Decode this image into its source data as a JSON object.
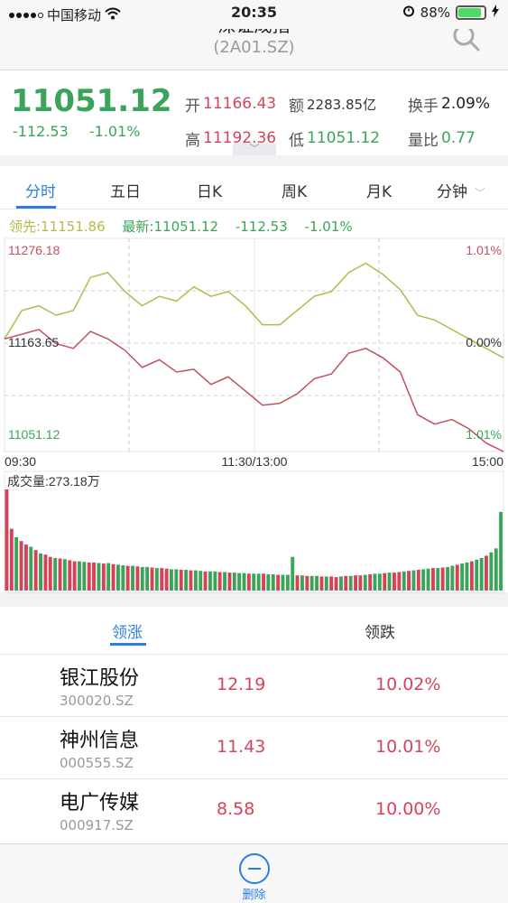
{
  "status_bar": {
    "carrier": "中国移动",
    "time": "20:35",
    "battery": "88%"
  },
  "header": {
    "title": "深证成指",
    "code": "(2A01.SZ)"
  },
  "quote": {
    "price": "11051.12",
    "change": "-112.53",
    "change_pct": "-1.01%",
    "open_label": "开",
    "open": "11166.43",
    "amount_label": "额",
    "amount": "2283.85亿",
    "turnover_label": "换手",
    "turnover": "2.09%",
    "high_label": "高",
    "high": "11192.36",
    "low_label": "低",
    "low": "11051.12",
    "vol_ratio_label": "量比",
    "vol_ratio": "0.77"
  },
  "tabs": [
    "分时",
    "五日",
    "日K",
    "周K",
    "月K",
    "分钟"
  ],
  "legend": {
    "lead": "领先:11151.86",
    "latest": "最新:11051.12",
    "change": "-112.53",
    "change_pct": "-1.01%"
  },
  "chart": {
    "y_top": "11276.18",
    "y_mid": "11163.65",
    "y_bottom": "11051.12",
    "pct_top": "1.01%",
    "pct_mid": "0.00%",
    "pct_bottom": "1.01%",
    "x_start": "09:30",
    "x_mid": "11:30/13:00",
    "x_end": "15:00",
    "volume_label": "成交量:273.18万"
  },
  "chart_data": {
    "type": "line",
    "ylim": [
      11051.12,
      11276.18
    ],
    "series": [
      {
        "name": "领先",
        "color": "#b8b84a",
        "values": [
          11170,
          11200,
          11205,
          11195,
          11200,
          11235,
          11240,
          11220,
          11205,
          11215,
          11210,
          11225,
          11215,
          11220,
          11205,
          11185,
          11185,
          11200,
          11215,
          11220,
          11240,
          11250,
          11238,
          11222,
          11195,
          11190,
          11180,
          11170,
          11160,
          11150
        ]
      },
      {
        "name": "最新",
        "color": "#c2525f",
        "values": [
          11170,
          11175,
          11180,
          11165,
          11160,
          11178,
          11170,
          11158,
          11140,
          11148,
          11135,
          11138,
          11122,
          11130,
          11115,
          11100,
          11102,
          11112,
          11128,
          11133,
          11155,
          11160,
          11150,
          11135,
          11090,
          11080,
          11085,
          11075,
          11060,
          11051
        ]
      }
    ],
    "volume": [
      180,
      110,
      95,
      88,
      82,
      78,
      72,
      66,
      64,
      60,
      58,
      57,
      56,
      54,
      52,
      52,
      51,
      50,
      50,
      49,
      48,
      49,
      47,
      46,
      45,
      44,
      44,
      43,
      42,
      42,
      41,
      40,
      40,
      39,
      38,
      38,
      37,
      37,
      36,
      36,
      35,
      34,
      34,
      34,
      33,
      33,
      32,
      32,
      31,
      31,
      30,
      30,
      30,
      30,
      29,
      29,
      28,
      28,
      28,
      60,
      27,
      27,
      26,
      26,
      26,
      25,
      25,
      25,
      24,
      25,
      26,
      26,
      27,
      27,
      28,
      29,
      30,
      30,
      31,
      32,
      32,
      33,
      34,
      35,
      36,
      37,
      38,
      39,
      40,
      40,
      41,
      42,
      44,
      46,
      48,
      50,
      52,
      55,
      58,
      62,
      68,
      75,
      140
    ],
    "volume_up": [
      1,
      1,
      0,
      1,
      1,
      0,
      1,
      0,
      1,
      1,
      0,
      1,
      0,
      1,
      1,
      0,
      0,
      1,
      1,
      0,
      1,
      0,
      1,
      0,
      0,
      1,
      0,
      1,
      0,
      0,
      1,
      0,
      1,
      1,
      0,
      0,
      1,
      0,
      1,
      0,
      0,
      1,
      0,
      0,
      1,
      0,
      1,
      0,
      0,
      0,
      1,
      0,
      0,
      1,
      0,
      0,
      1,
      0,
      0,
      0,
      1,
      0,
      1,
      0,
      0,
      1,
      0,
      1,
      1,
      0,
      1,
      0,
      1,
      1,
      0,
      1,
      0,
      0,
      1,
      0,
      1,
      1,
      0,
      1,
      0,
      1,
      0,
      0,
      1,
      0,
      1,
      0,
      0,
      1,
      0,
      0,
      1,
      0,
      0,
      1,
      0,
      0,
      0
    ]
  },
  "list_tabs": [
    "领涨",
    "领跌"
  ],
  "list": [
    {
      "name": "银江股份",
      "code": "300020.SZ",
      "price": "12.19",
      "pct": "10.02%"
    },
    {
      "name": "神州信息",
      "code": "000555.SZ",
      "price": "11.43",
      "pct": "10.01%"
    },
    {
      "name": "电广传媒",
      "code": "000917.SZ",
      "price": "8.58",
      "pct": "10.00%"
    }
  ],
  "bottom": {
    "delete_label": "删除"
  }
}
